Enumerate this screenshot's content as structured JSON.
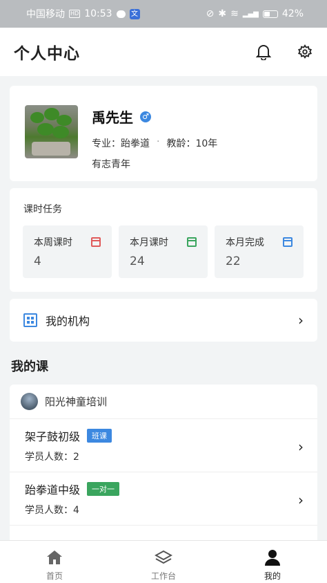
{
  "status_bar": {
    "carrier": "中国移动",
    "hd": "HD",
    "time": "10:53",
    "battery": "42%"
  },
  "header": {
    "title": "个人中心"
  },
  "profile": {
    "name": "禹先生",
    "major_label": "专业：",
    "major": "跆拳道",
    "separator": "·",
    "seniority_label": "教龄：",
    "seniority": "10年",
    "motto": "有志青年"
  },
  "tasks": {
    "title": "课时任务",
    "items": [
      {
        "label": "本周课时",
        "value": "4",
        "color": "#e05a5a"
      },
      {
        "label": "本月课时",
        "value": "24",
        "color": "#3aa55e"
      },
      {
        "label": "本月完成",
        "value": "22",
        "color": "#3c88e0"
      }
    ]
  },
  "org_link": {
    "label": "我的机构"
  },
  "my_courses": {
    "title": "我的课",
    "org_name": "阳光神童培训",
    "courses": [
      {
        "name": "架子鼓初级",
        "tag": "班课",
        "students_label": "学员人数：",
        "students": "2"
      },
      {
        "name": "跆拳道中级",
        "tag": "一对一",
        "students_label": "学员人数：",
        "students": "4"
      }
    ]
  },
  "tabbar": {
    "tabs": [
      {
        "label": "首页"
      },
      {
        "label": "工作台"
      },
      {
        "label": "我的"
      }
    ]
  },
  "colors": {
    "accent": "#3c88e0",
    "green": "#3aa55e",
    "red": "#e05a5a"
  }
}
